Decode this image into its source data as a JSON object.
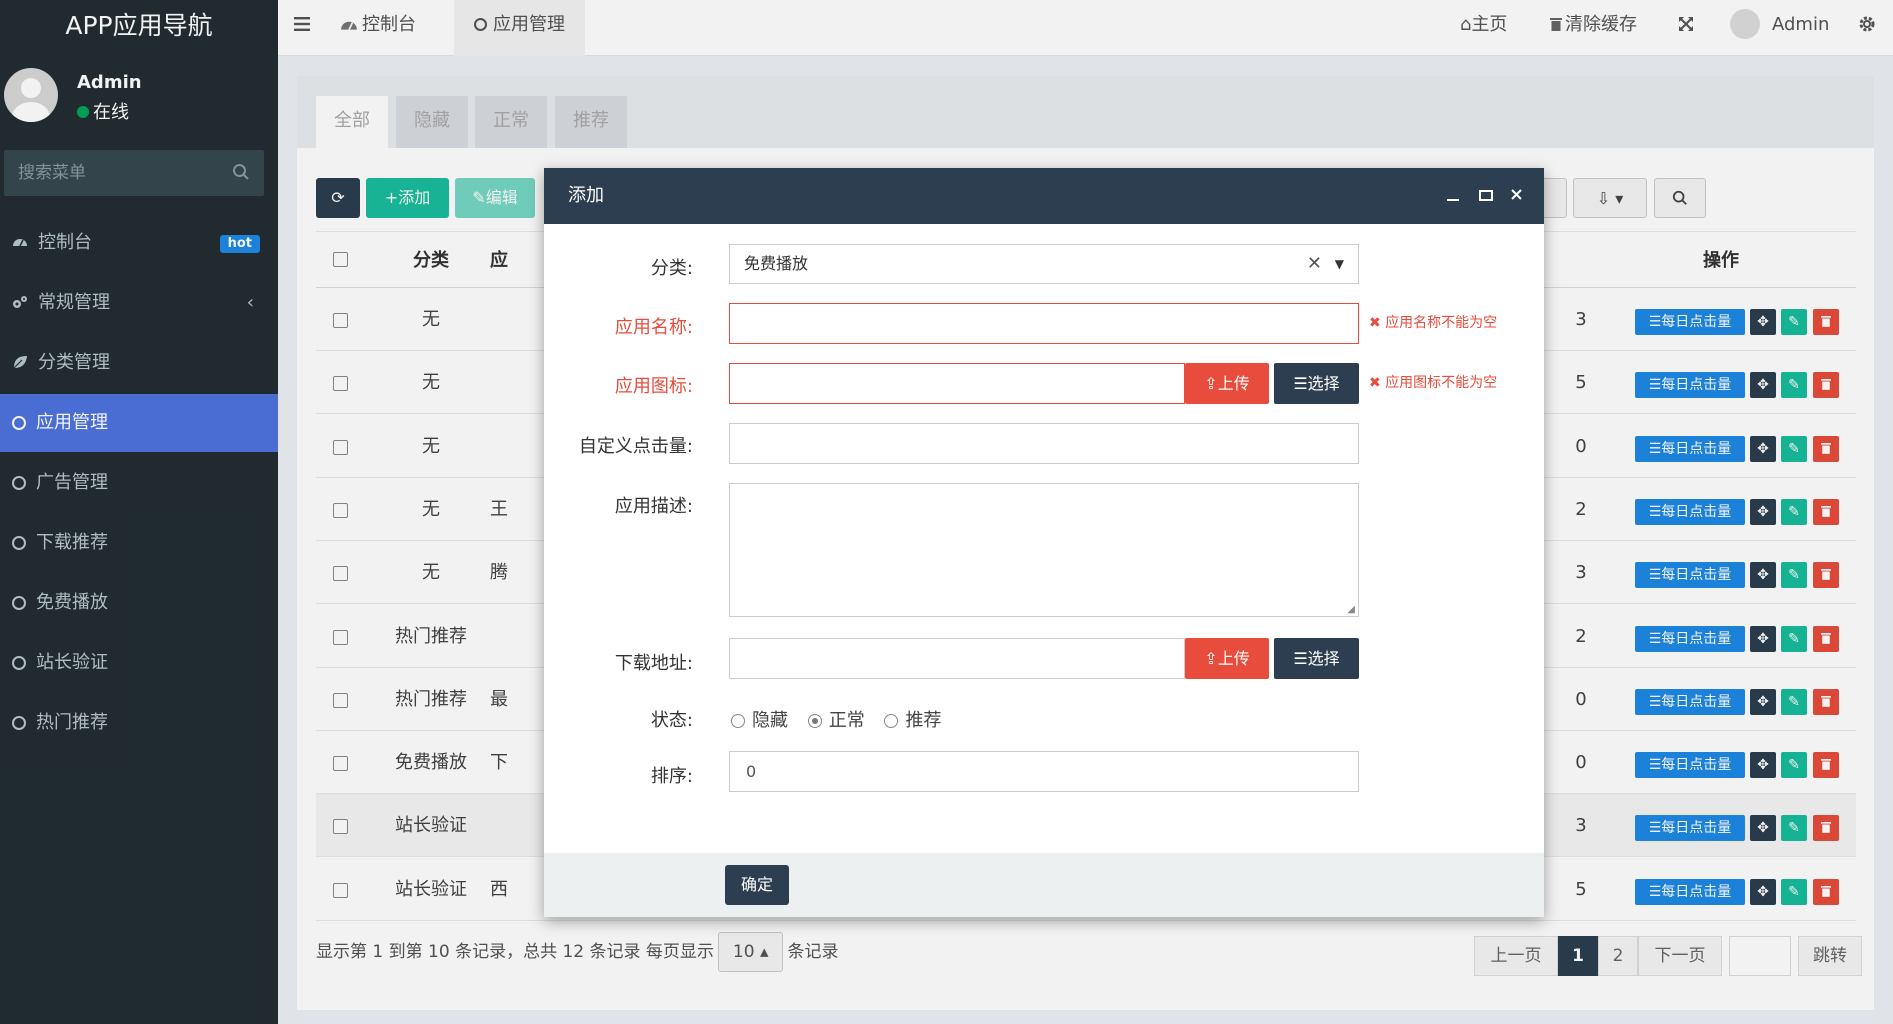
{
  "app": {
    "logo": "APP应用导航"
  },
  "user": {
    "name": "Admin",
    "status": "在线"
  },
  "sidebar": {
    "search_placeholder": "搜索菜单",
    "items": [
      {
        "label": "控制台",
        "badge": "hot"
      },
      {
        "label": "常规管理"
      },
      {
        "label": "分类管理"
      },
      {
        "label": "应用管理"
      },
      {
        "label": "广告管理"
      },
      {
        "label": "下载推荐"
      },
      {
        "label": "免费播放"
      },
      {
        "label": "站长验证"
      },
      {
        "label": "热门推荐"
      }
    ]
  },
  "topbar": {
    "tabs": [
      {
        "label": "控制台"
      },
      {
        "label": "应用管理"
      }
    ],
    "home": "主页",
    "clear_cache": "清除缓存",
    "admin": "Admin"
  },
  "content": {
    "filter_tabs": [
      "全部",
      "隐藏",
      "正常",
      "推荐"
    ],
    "toolbar": {
      "add": "添加",
      "edit": "编辑"
    },
    "table": {
      "headers": {
        "category": "分类",
        "app": "应",
        "actions": "操作"
      },
      "rows": [
        {
          "category": "无",
          "partial": "",
          "right": "3"
        },
        {
          "category": "无",
          "partial": "",
          "right": "5"
        },
        {
          "category": "无",
          "partial": "",
          "right": "0"
        },
        {
          "category": "无",
          "partial": "王",
          "right": "2"
        },
        {
          "category": "无",
          "partial": "腾",
          "right": "3"
        },
        {
          "category": "热门推荐",
          "partial": "",
          "right": "2"
        },
        {
          "category": "热门推荐",
          "partial": "最",
          "right": "0"
        },
        {
          "category": "免费播放",
          "partial": "下",
          "right": "0"
        },
        {
          "category": "站长验证",
          "partial": "",
          "right": "3"
        },
        {
          "category": "站长验证",
          "partial": "西",
          "right": "5"
        }
      ],
      "action_label": "每日点击量"
    },
    "footer": {
      "info_prefix": "显示第 1 到第 10 条记录，总共 12 条记录 每页显示",
      "page_size": "10",
      "info_suffix": "条记录",
      "prev": "上一页",
      "pages": [
        "1",
        "2"
      ],
      "next": "下一页",
      "jump": "跳转"
    }
  },
  "modal": {
    "title": "添加",
    "fields": {
      "category_label": "分类:",
      "category_value": "免费播放",
      "name_label": "应用名称:",
      "name_error": "应用名称不能为空",
      "icon_label": "应用图标:",
      "icon_error": "应用图标不能为空",
      "clicks_label": "自定义点击量:",
      "desc_label": "应用描述:",
      "download_label": "下载地址:",
      "status_label": "状态:",
      "status_options": [
        "隐藏",
        "正常",
        "推荐"
      ],
      "status_selected": "正常",
      "sort_label": "排序:",
      "sort_value": "0"
    },
    "upload": "上传",
    "choose": "选择",
    "ok": "确定"
  },
  "colors": {
    "sidebar_bg": "#222d32",
    "active_menu": "#4e73df",
    "modal_header": "#2c3e50",
    "success": "#1abc9c",
    "danger": "#e74c3c",
    "info": "#1e88e5",
    "primary_dark": "#2c3e50"
  }
}
